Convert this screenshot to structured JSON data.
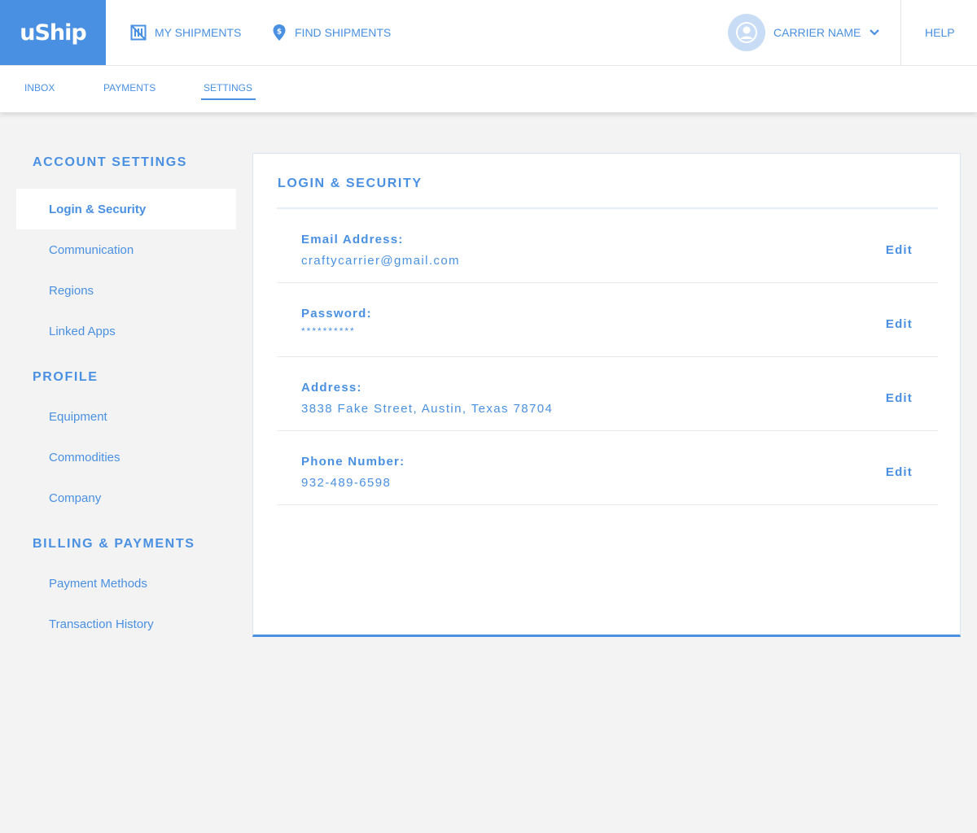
{
  "brand": {
    "logo_text": "uShip",
    "accent": "#4a90e2"
  },
  "topnav": {
    "my_shipments": {
      "label": "MY SHIPMENTS",
      "icon": "shipments-icon"
    },
    "find_shipments": {
      "label": "FIND SHIPMENTS",
      "icon": "location-pin-icon"
    },
    "user": {
      "name": "CARRIER NAME",
      "icon": "avatar-icon"
    },
    "help": "HELP"
  },
  "subnav": {
    "tabs": [
      {
        "label": "INBOX",
        "active": false
      },
      {
        "label": "PAYMENTS",
        "active": false
      },
      {
        "label": "SETTINGS",
        "active": true
      }
    ]
  },
  "sidebar": {
    "sections": [
      {
        "title": "ACCOUNT SETTINGS",
        "items": [
          "Login & Security",
          "Communication",
          "Regions",
          "Linked Apps"
        ]
      },
      {
        "title": "PROFILE",
        "items": [
          "Equipment",
          "Commodities",
          "Company"
        ]
      },
      {
        "title": "BILLING & PAYMENTS",
        "items": [
          "Payment Methods",
          "Transaction History"
        ]
      }
    ],
    "active_item": "Login & Security"
  },
  "panel": {
    "title": "LOGIN & SECURITY",
    "rows": [
      {
        "label": "Email Address:",
        "value": "craftycarrier@gmail.com",
        "action": "Edit"
      },
      {
        "label": "Password:",
        "value": "**********",
        "action": "Edit"
      },
      {
        "label": "Address:",
        "value": "3838 Fake Street, Austin, Texas 78704",
        "action": "Edit"
      },
      {
        "label": "Phone Number:",
        "value": "932-489-6598",
        "action": "Edit"
      }
    ]
  }
}
